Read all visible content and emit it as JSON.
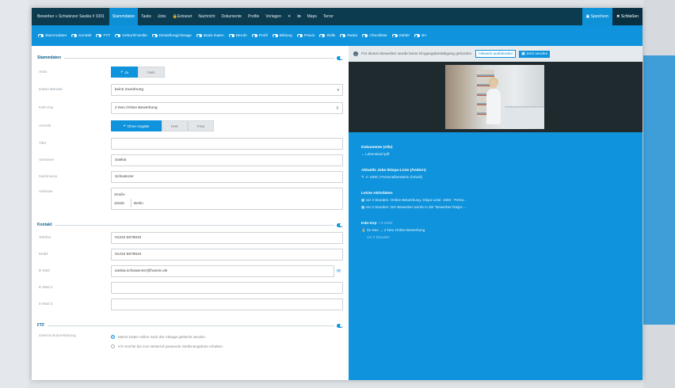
{
  "topbar": {
    "title": "Bewerber » Schwänzer Saskia # 1001",
    "items": [
      "Stammdaten",
      "Tasks",
      "Jobs",
      "Extranet",
      "Nachricht",
      "Dokumente",
      "Profile",
      "Vorlagen",
      "Maps",
      "Terror"
    ],
    "active_index": 0,
    "save_label": "Speichern",
    "close_label": "Schließen"
  },
  "tabs": [
    "Stammdaten",
    "Kontakt",
    "FTF",
    "Geburt/Familie",
    "Einstellung/Absage",
    "Basis Daten",
    "Berufe",
    "Profil",
    "Bildung",
    "Praxis",
    "Skills",
    "Radar",
    "Checkliste",
    "Zahler",
    "BA"
  ],
  "stammdaten": {
    "section_title": "Stammdaten",
    "aktiv": {
      "label": "Aktiv",
      "yes": "Ja",
      "no": "Nein"
    },
    "daten_berater": {
      "label": "Daten-Berater",
      "value": "keine Zuordnung"
    },
    "kdn_grp": {
      "label": "Kdn-Grp",
      "value": "2 Neu Online Bewerbung"
    },
    "anrede": {
      "label": "Anrede",
      "options": [
        "Ohne Angabe",
        "Herr",
        "Frau"
      ]
    },
    "titel": {
      "label": "Titel",
      "value": ""
    },
    "vorname": {
      "label": "Vorname",
      "value": "Saskia"
    },
    "nachname": {
      "label": "Nachname",
      "value": "Schwänzer"
    },
    "adresse": {
      "label": "Adresse",
      "strasse": "Straße",
      "plz": "10225",
      "ort": "Berlin"
    }
  },
  "kontakt": {
    "section_title": "Kontakt",
    "telefon": {
      "label": "Telefon",
      "value": "01234 5678910"
    },
    "mobil": {
      "label": "Mobil",
      "value": "01234 5678910"
    },
    "email": {
      "label": "E-Mail",
      "value": "saskia.schwaenzer@hannin.de"
    },
    "email2": {
      "label": "E-Mail 2",
      "value": ""
    },
    "email3": {
      "label": "E-Mail 3",
      "value": ""
    }
  },
  "ftf": {
    "section_title": "FTF",
    "datenschutz_label": "Datenschutzerklärung",
    "option1": "Meine Daten sollen nach der Absage gelöscht werden.",
    "option2": "Ich möchte bis zum Widerruf passende Stellenangebote erhalten."
  },
  "right": {
    "info_text": "Für diesen Bewerber wurde keine Eingangsbestätigung gefunden",
    "info_btn1": "Hinweis ausblenden",
    "info_btn2": "Jetzt senden",
    "dokumente_title": "Dokumente (Alle)",
    "dokumente_item": "Lebenslauf.pdf",
    "jobs_title": "Aktuelle Jobs-/Dispo-Liste (Ändern)",
    "jobs_item": "1000 | Personalberaterin (m/w/d)",
    "aktivitaeten_title": "Letzte Aktivitäten",
    "aktivitaet1": "vor 3 Stunden: Online-Bewerbung, Dispo-Liste: 1000 - Perso...",
    "aktivitaet2": "vor 3 Stunden: Der Bewerber wurde in die \"Bewerber-Dispo-...",
    "kdn_title": "Kdn-Grp",
    "kdn_sub": "+ 0 mehr",
    "kdn_item": "01 Neu → 2 Neu Online Bewerbung",
    "kdn_time": "vor 3 Stunden"
  },
  "colors": {
    "accent": "#0e93dc",
    "topbar": "#0c3a4e"
  }
}
